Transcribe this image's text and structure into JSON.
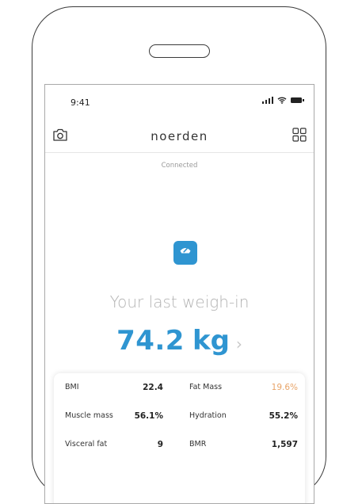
{
  "status_bar": {
    "time": "9:41",
    "icons": [
      "cellular-signal-icon",
      "wifi-icon",
      "battery-icon"
    ]
  },
  "nav": {
    "brand": "noerden",
    "left_icon": "camera-icon",
    "right_icon": "grid-icon"
  },
  "connection_status": "Connected",
  "weigh_in": {
    "icon": "scale-icon",
    "title": "Your last weigh-in",
    "value": "74.2",
    "unit": "kg",
    "chevron": "›"
  },
  "metrics": [
    {
      "left_label": "BMI",
      "left_value": "22.4",
      "right_label": "Fat Mass",
      "right_value": "19.6%"
    },
    {
      "left_label": "Muscle mass",
      "left_value": "56.1%",
      "right_label": "Hydration",
      "right_value": "55.2%"
    },
    {
      "left_label": "Visceral fat",
      "left_value": "9",
      "right_label": "BMR",
      "right_value": "1,597"
    }
  ],
  "colors": {
    "accent": "#2f95d1",
    "warning": "#e8a468",
    "muted_text": "#b3b3b3"
  }
}
